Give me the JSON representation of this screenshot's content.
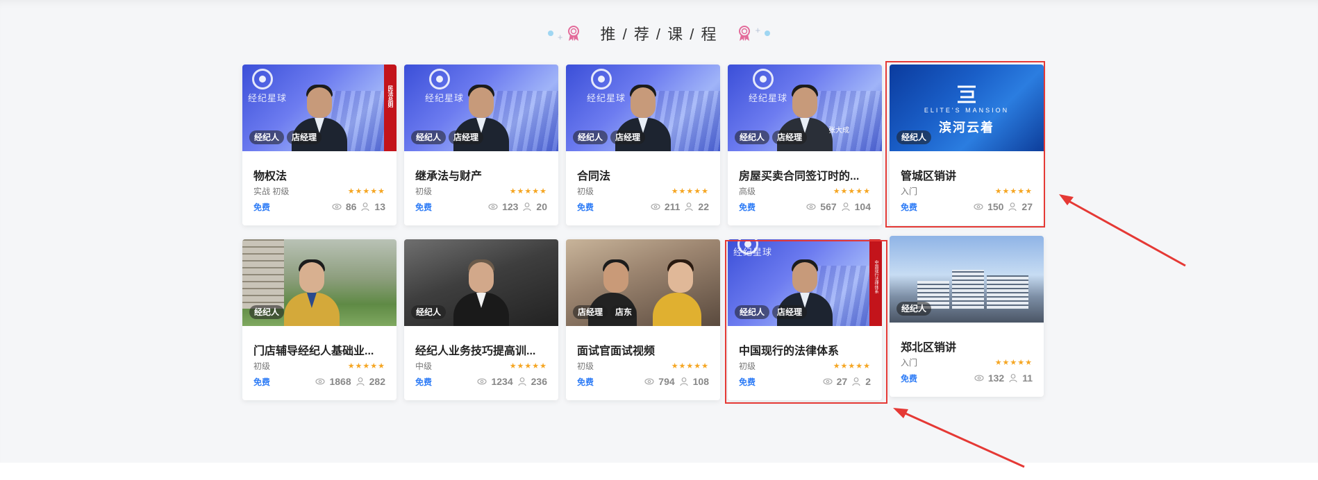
{
  "section": {
    "title": "推 / 荐 / 课 / 程"
  },
  "colors": {
    "accent_blue": "#2e7cf6",
    "star": "#f5a623",
    "highlight": "#e53935"
  },
  "courses": [
    {
      "title": "物权法",
      "level": "实战 初级",
      "price": "免费",
      "views": "86",
      "students": "13",
      "rating": "★★★★★",
      "tags": [
        "经纪人",
        "店经理"
      ],
      "thumb_text": "经纪星球",
      "strip_text": "民法总则"
    },
    {
      "title": "继承法与财产",
      "level": "初级",
      "price": "免费",
      "views": "123",
      "students": "20",
      "rating": "★★★★★",
      "tags": [
        "经纪人",
        "店经理"
      ],
      "thumb_text": "经纪星球"
    },
    {
      "title": "合同法",
      "level": "初级",
      "price": "免费",
      "views": "211",
      "students": "22",
      "rating": "★★★★★",
      "tags": [
        "经纪人",
        "店经理"
      ],
      "thumb_text": "经纪星球"
    },
    {
      "title": "房屋买卖合同签订时的...",
      "level": "高级",
      "price": "免费",
      "views": "567",
      "students": "104",
      "rating": "★★★★★",
      "tags": [
        "经纪人",
        "店经理"
      ],
      "thumb_text": "经纪星球",
      "caption": "张大成"
    },
    {
      "title": "管城区销讲",
      "level": "入门",
      "price": "免费",
      "views": "150",
      "students": "27",
      "rating": "★★★★★",
      "tags": [
        "经纪人"
      ],
      "brand_small": "ELITE'S MANSION",
      "brand_big": "滨河云着"
    },
    {
      "title": "门店辅导经纪人基础业...",
      "level": "初级",
      "price": "免费",
      "views": "1868",
      "students": "282",
      "rating": "★★★★★",
      "tags": [
        "经纪人"
      ]
    },
    {
      "title": "经纪人业务技巧提高训...",
      "level": "中级",
      "price": "免费",
      "views": "1234",
      "students": "236",
      "rating": "★★★★★",
      "tags": [
        "经纪人"
      ]
    },
    {
      "title": "面试官面试视频",
      "level": "初级",
      "price": "免费",
      "views": "794",
      "students": "108",
      "rating": "★★★★★",
      "tags": [
        "店经理",
        "店东"
      ]
    },
    {
      "title": "中国现行的法律体系",
      "level": "初级",
      "price": "免费",
      "views": "27",
      "students": "2",
      "rating": "★★★★★",
      "tags": [
        "经纪人",
        "店经理"
      ],
      "thumb_text": "经纪星球",
      "strip_text": "中国现行法律体系"
    },
    {
      "title": "郑北区销讲",
      "level": "入门",
      "price": "免费",
      "views": "132",
      "students": "11",
      "rating": "★★★★★",
      "tags": [
        "经纪人"
      ]
    }
  ]
}
